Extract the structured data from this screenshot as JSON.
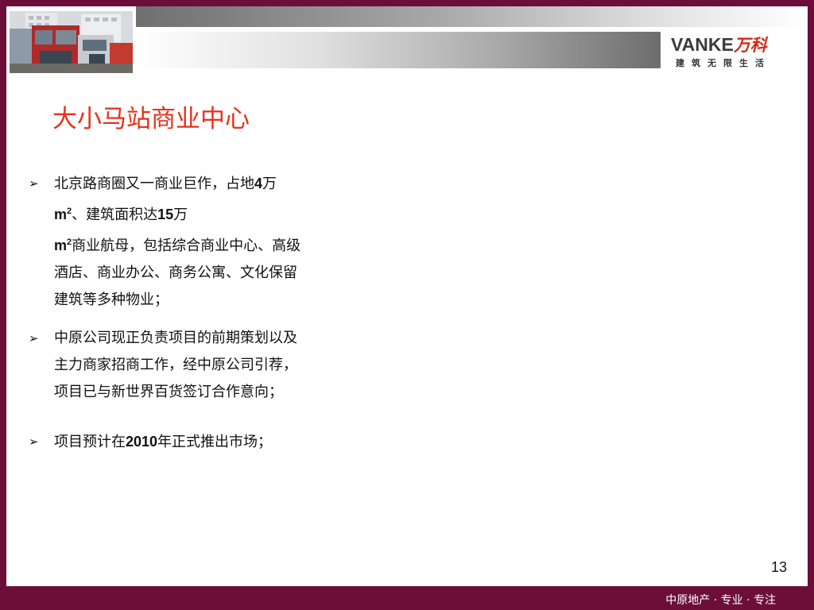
{
  "header": {
    "logo_en": "VANKE",
    "logo_cn": "万科",
    "logo_tagline": "建筑无限生活"
  },
  "slide": {
    "title": "大小马站商业中心",
    "bullets": [
      {
        "p1": "北京路商圈又一商业巨作，占地",
        "n1": "4",
        "p2": "万",
        "u1": "m",
        "s1": "2",
        "p3": "、建筑面积达",
        "n2": "15",
        "p4": "万",
        "u2": "m",
        "s2": "2",
        "p5": "商业航母，包括综合商业中心、高级酒店、商业办公、商务公寓、文化保留建筑等多种物业；"
      },
      {
        "text": "中原公司现正负责项目的前期策划以及主力商家招商工作，经中原公司引荐，项目已与新世界百货签订合作意向；"
      },
      {
        "p1": "项目预计在",
        "n1": "2010",
        "p2": "年正式推出市场；"
      }
    ],
    "page_number": "13"
  },
  "footer": {
    "text": "中原地产 · 专业 · 专注"
  },
  "colors": {
    "frame": "#6b0f3a",
    "title": "#e8311a",
    "logo_red": "#d4291a"
  }
}
